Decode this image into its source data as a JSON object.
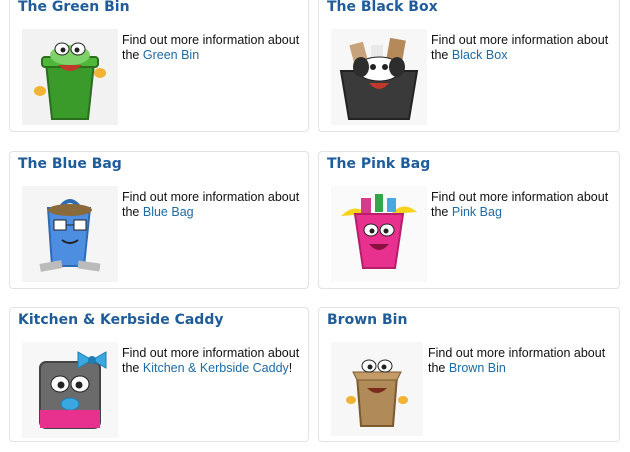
{
  "cards": [
    {
      "title": "The Green Bin",
      "text": "Find out more information about the ",
      "link": "Green Bin",
      "after": "",
      "icon": "green-bin-character-icon"
    },
    {
      "title": "The Black Box",
      "text": "Find out more information about the ",
      "link": "Black Box",
      "after": "",
      "icon": "black-box-character-icon"
    },
    {
      "title": "The Blue Bag",
      "text": "Find out more information about the ",
      "link": "Blue Bag",
      "after": "",
      "icon": "blue-bag-character-icon"
    },
    {
      "title": "The Pink Bag",
      "text": "Find out more information about the ",
      "link": "Pink Bag",
      "after": "",
      "icon": "pink-bag-character-icon"
    },
    {
      "title": "Kitchen & Kerbside Caddy",
      "text": "Find out more information about the ",
      "link": "Kitchen & Kerbside Caddy",
      "after": "!",
      "icon": "kitchen-caddy-character-icon"
    },
    {
      "title": "Brown Bin",
      "text": "Find out more information about the ",
      "link": "Brown Bin",
      "after": "",
      "icon": "brown-bin-character-icon"
    }
  ],
  "colors": {
    "title": "#1f5c99",
    "link": "#1c6aa6",
    "border": "#e3e3e3"
  }
}
